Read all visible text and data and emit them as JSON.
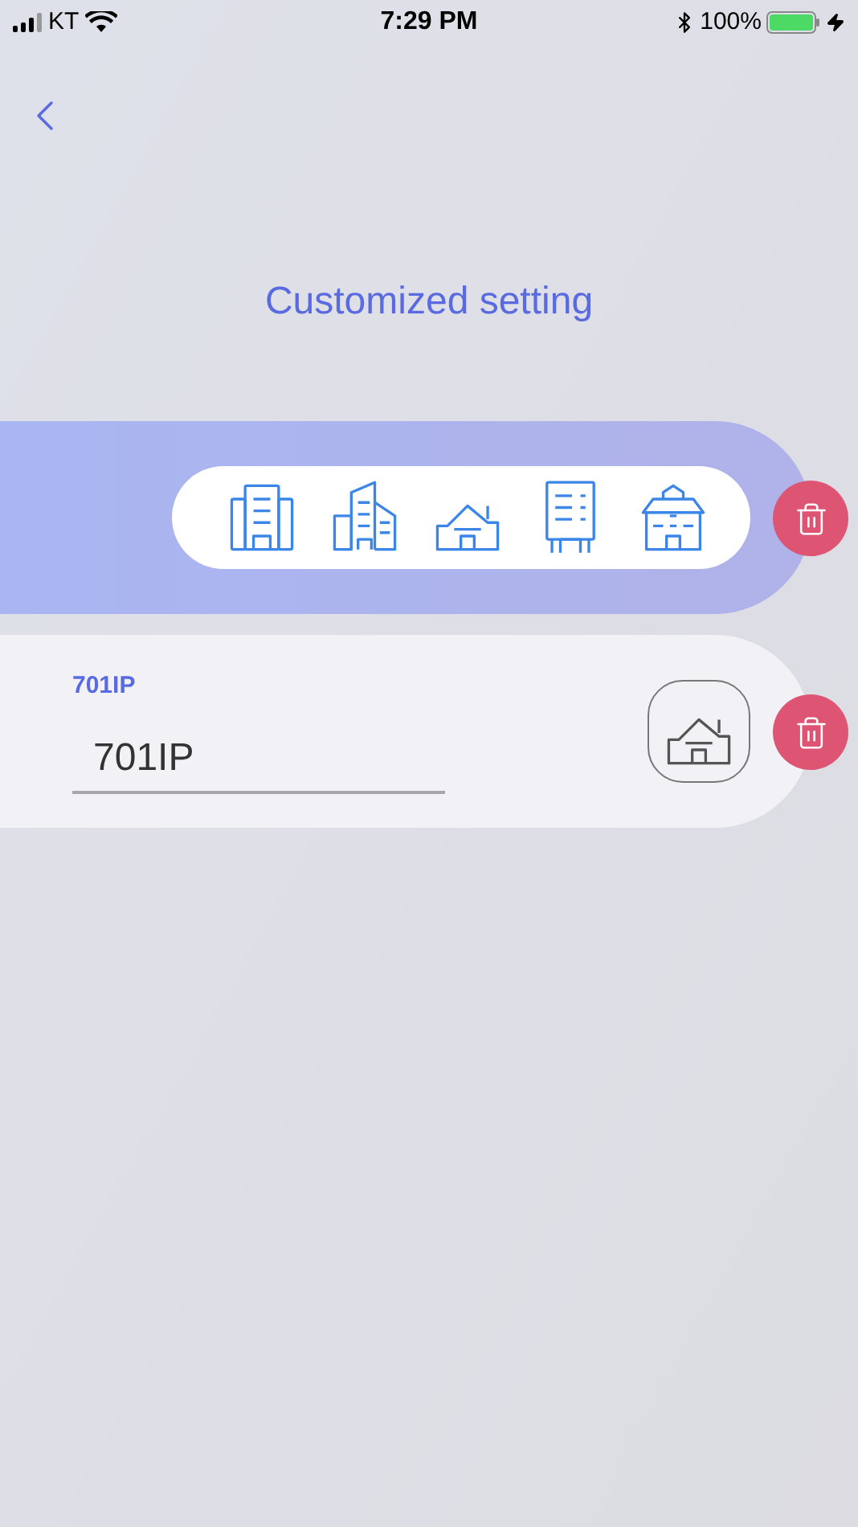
{
  "status_bar": {
    "carrier": "KT",
    "time": "7:29 PM",
    "battery": "100%"
  },
  "title": "Customized setting",
  "entry": {
    "label": "701IP",
    "value": "701IP"
  }
}
